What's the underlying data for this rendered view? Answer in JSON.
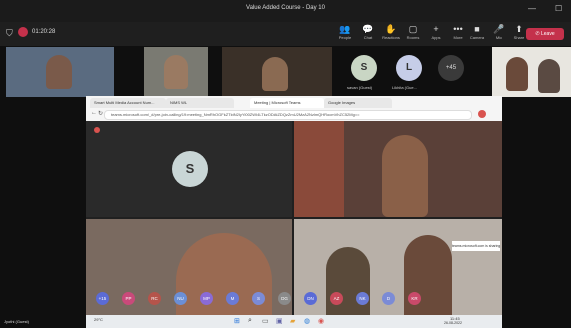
{
  "window": {
    "title": "Value Added Course - Day 10",
    "timer": "01:20:28"
  },
  "toolbar": {
    "items": [
      {
        "icon": "people-icon",
        "glyph": "👥",
        "label": "People"
      },
      {
        "icon": "chat-icon",
        "glyph": "💬",
        "label": "Chat"
      },
      {
        "icon": "reactions-icon",
        "glyph": "✋",
        "label": "Reactions"
      },
      {
        "icon": "rooms-icon",
        "glyph": "▢",
        "label": "Rooms"
      },
      {
        "icon": "apps-icon",
        "glyph": "+",
        "label": "Apps"
      },
      {
        "icon": "more-icon",
        "glyph": "•••",
        "label": "More"
      },
      {
        "icon": "camera-icon",
        "glyph": "■",
        "label": "Camera"
      },
      {
        "icon": "mic-icon",
        "glyph": "🎤",
        "label": "Mic"
      },
      {
        "icon": "share-icon",
        "glyph": "⬆",
        "label": "Share"
      }
    ],
    "leave_label": "Leave"
  },
  "strip": {
    "avatars": [
      {
        "initial": "S",
        "name": "savan (Guest)",
        "color": "#c9d6c4"
      },
      {
        "initial": "L",
        "name": "Likhita (Gue...",
        "color": "#c6cde8"
      }
    ],
    "overflow": "+45"
  },
  "browser": {
    "tabs": [
      "Smart Multi Media Account Num...",
      "NIMS WL",
      "Meeting | Microsoft Teams",
      "Google Images"
    ],
    "url": "teams.microsoft.com/_#/pre-join-calling/19:meeting_NmRhOGFkZTktN2IyYi00ZWI4LTkzODAtZDQzZmU2MzA2NzlmQHRocmVhZC52Mg==",
    "meeting_avatar": "S",
    "share_notice": "teams.microsoft.com is sharing your screen.",
    "chips": [
      {
        "label": "+15",
        "color": "#5b6bd6"
      },
      {
        "label": "PP",
        "color": "#c94a7a"
      },
      {
        "label": "RC",
        "color": "#b5544b"
      },
      {
        "label": "NU",
        "color": "#6b8fd6"
      },
      {
        "label": "MP",
        "color": "#8a6bd6"
      },
      {
        "label": "M",
        "color": "#6b7bd6"
      },
      {
        "label": "S",
        "color": "#7b8bd6"
      },
      {
        "label": "DG",
        "color": "#8a8a8a"
      },
      {
        "label": "DN",
        "color": "#5a6bd6"
      },
      {
        "label": "AZ",
        "color": "#c94a5a"
      },
      {
        "label": "NK",
        "color": "#6b7bd6"
      },
      {
        "label": "D",
        "color": "#7b8bd6"
      },
      {
        "label": "KR",
        "color": "#c94a6a"
      }
    ]
  },
  "footer": {
    "self_name": "Jyothi (Guest)",
    "weather": "29°C",
    "time": "11:45",
    "date": "26-08-2022"
  }
}
